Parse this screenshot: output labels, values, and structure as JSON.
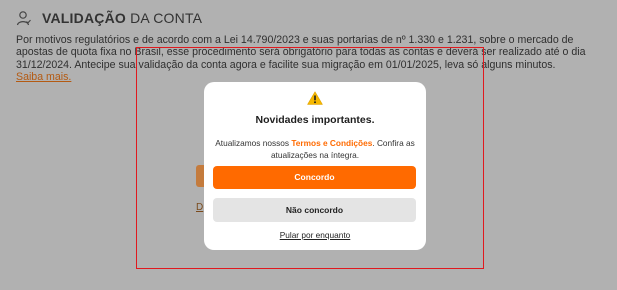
{
  "header": {
    "title_bold": "VALIDAÇÃO",
    "title_rest": " DA CONTA"
  },
  "description": {
    "text": "Por motivos regulatórios e de acordo com a Lei 14.790/2023 e suas portarias de nº 1.330 e 1.231, sobre o mercado de apostas de quota fixa no Brasil, esse procedimento será obrigatório para todas as contas e deverá ser realizado até o dia 31/12/2024. Antecipe sua validação da conta agora e facilite sua migração em 01/01/2025, leva só alguns minutos.",
    "link": "Saiba mais."
  },
  "background_fragments": {
    "link_fragment": "D"
  },
  "modal": {
    "icon": "warning-icon",
    "title": "Novidades importantes.",
    "text_before": "Atualizamos nossos ",
    "text_highlight": "Termos e Condições",
    "text_after": ". Confira as atualizações na íntegra.",
    "agree_label": "Concordo",
    "disagree_label": "Não concordo",
    "skip_label": "Pular por enquanto"
  },
  "colors": {
    "accent": "#ff6a00",
    "overlay_bg": "#b1b1b1",
    "highlight_frame": "#e0191e"
  }
}
